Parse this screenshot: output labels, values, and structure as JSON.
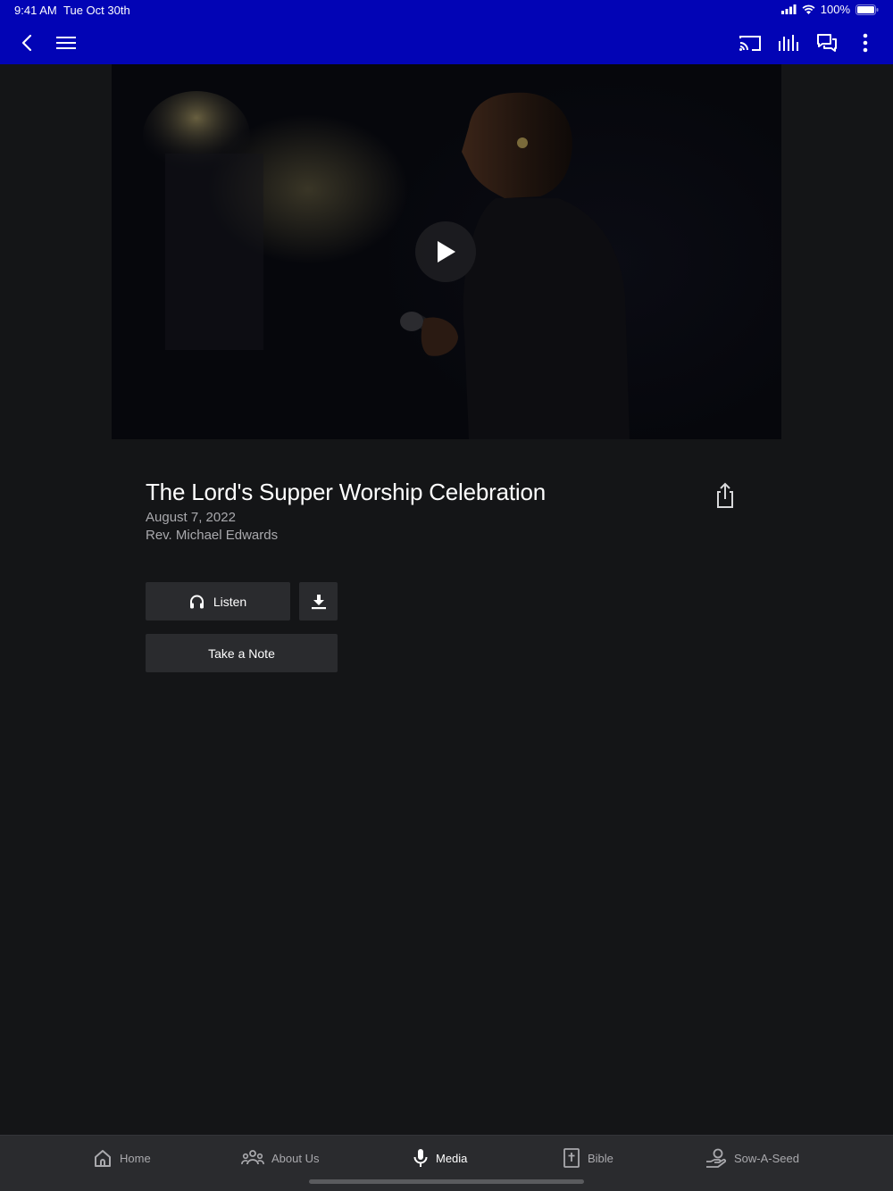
{
  "status": {
    "time": "9:41 AM",
    "date": "Tue Oct 30th",
    "battery": "100%"
  },
  "navbar": {
    "icons": [
      "back-icon",
      "menu-icon",
      "cast-icon",
      "audio-bars-icon",
      "chat-icon",
      "more-vert-icon"
    ]
  },
  "sermon": {
    "title": "The Lord's Supper Worship Celebration",
    "date": "August 7, 2022",
    "speaker": "Rev. Michael Edwards"
  },
  "actions": {
    "listen_label": "Listen",
    "note_label": "Take a Note"
  },
  "tabs": [
    {
      "label": "Home",
      "icon": "home-icon",
      "active": false
    },
    {
      "label": "About Us",
      "icon": "people-icon",
      "active": false
    },
    {
      "label": "Media",
      "icon": "microphone-icon",
      "active": true
    },
    {
      "label": "Bible",
      "icon": "bible-icon",
      "active": false
    },
    {
      "label": "Sow-A-Seed",
      "icon": "giving-hand-icon",
      "active": false
    }
  ],
  "colors": {
    "header": "#0204b5",
    "background": "#141517",
    "button": "#2a2b2e",
    "tabbar": "#2a2b2e"
  }
}
